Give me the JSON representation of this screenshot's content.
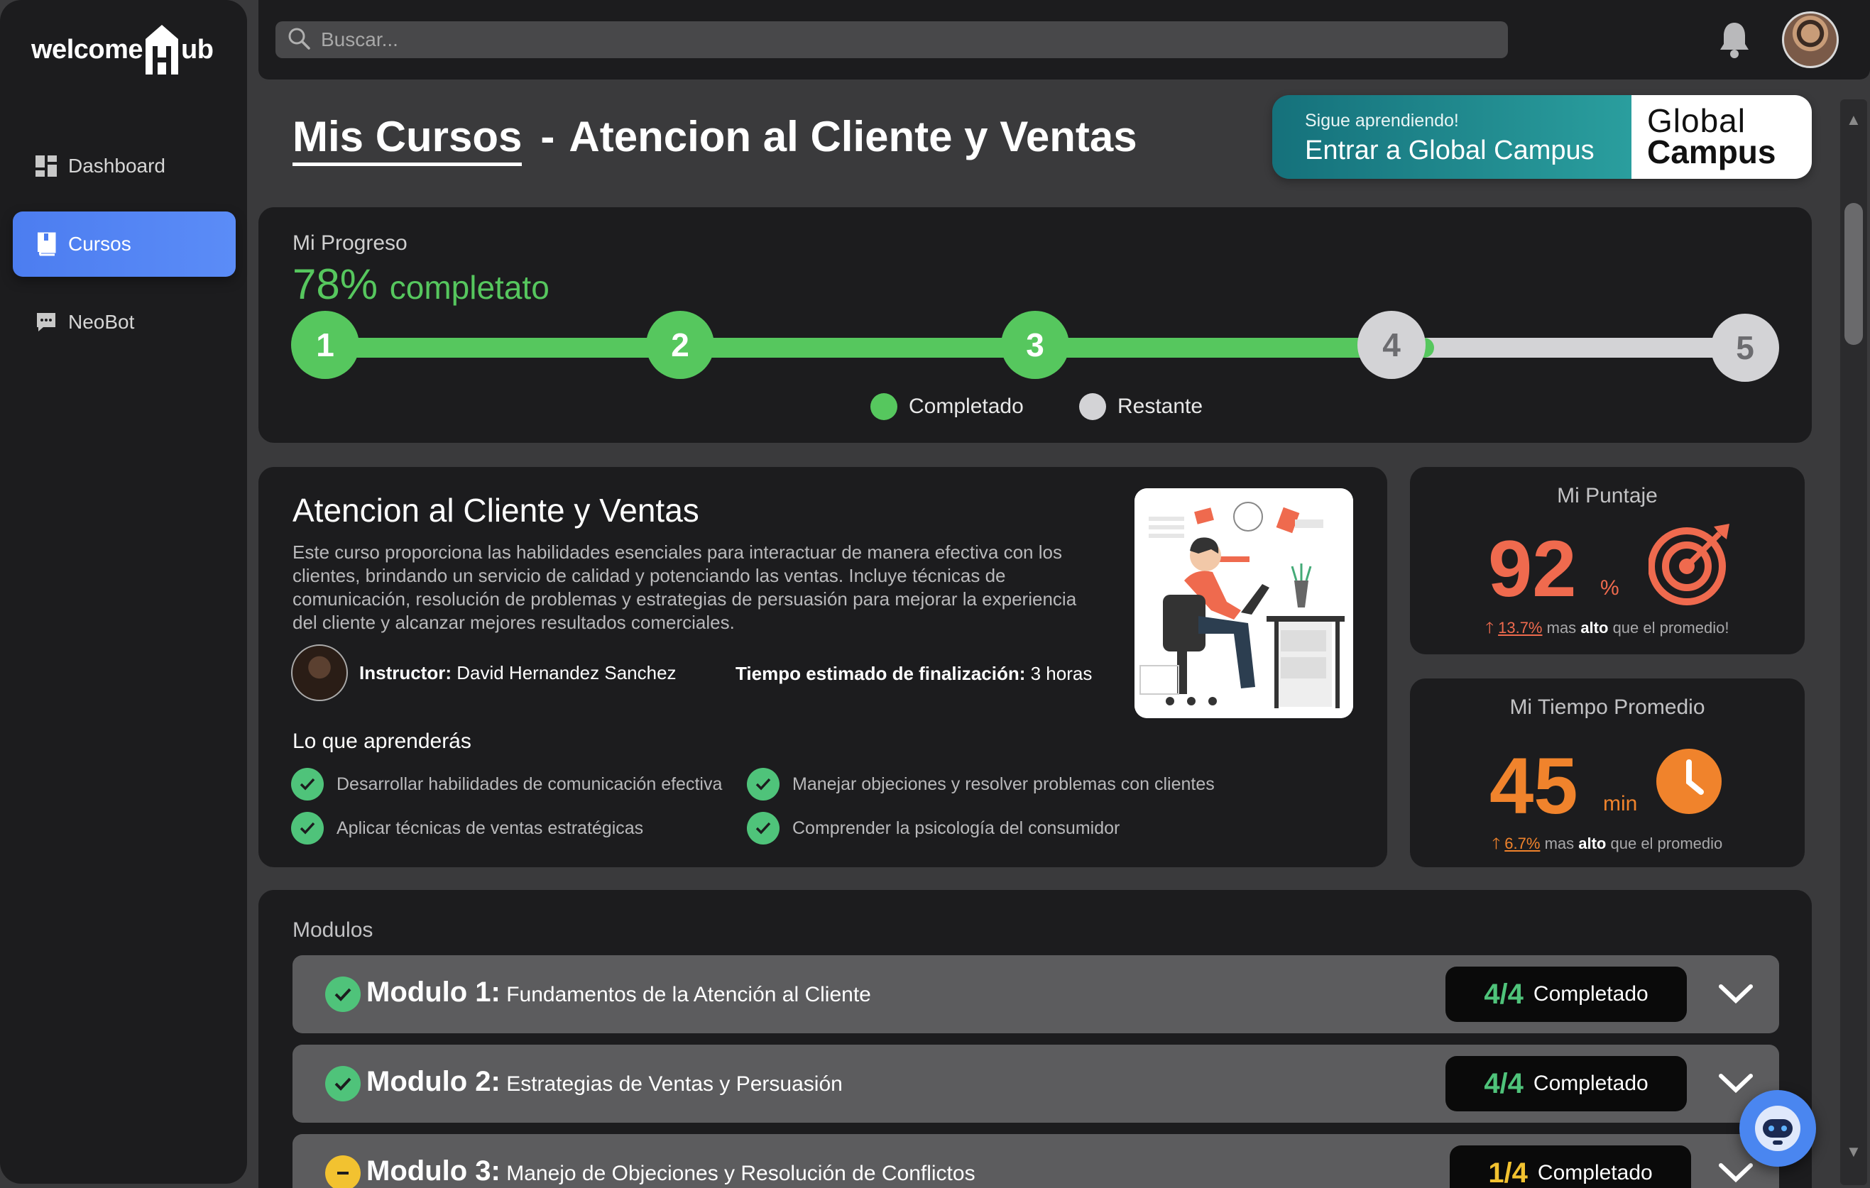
{
  "brand": {
    "logo_pre": "welcome",
    "logo_post": "ub"
  },
  "sidebar": {
    "items": [
      {
        "label": "Dashboard",
        "icon": "dashboard-icon",
        "active": false
      },
      {
        "label": "Cursos",
        "icon": "book-icon",
        "active": true
      },
      {
        "label": "NeoBot",
        "icon": "chat-icon",
        "active": false
      }
    ]
  },
  "topbar": {
    "search_placeholder": "Buscar...",
    "bell_icon": "bell-icon",
    "avatar_icon": "user-avatar"
  },
  "header": {
    "crumb": "Mis Cursos",
    "separator": "-",
    "course_name": "Atencion al Cliente y Ventas"
  },
  "campus": {
    "subtitle": "Sigue aprendiendo!",
    "cta": "Entrar a Global Campus",
    "logo_line1": "Global",
    "logo_line2": "Campus"
  },
  "progress": {
    "label": "Mi Progreso",
    "percent_text": "78%",
    "percent_word": "completato",
    "percent_value": 78,
    "steps": [
      {
        "label": "1",
        "status": "done"
      },
      {
        "label": "2",
        "status": "done"
      },
      {
        "label": "3",
        "status": "done"
      },
      {
        "label": "4",
        "status": "todo"
      },
      {
        "label": "5",
        "status": "todo"
      }
    ],
    "legend_done": "Completado",
    "legend_todo": "Restante",
    "colors": {
      "done": "#56c75e",
      "todo": "#d3d3d6"
    }
  },
  "course": {
    "title": "Atencion al Cliente y Ventas",
    "description": "Este curso proporciona las habilidades esenciales para interactuar de manera efectiva con los clientes, brindando un servicio de calidad y potenciando las ventas. Incluye técnicas de comunicación, resolución de problemas y estrategias de persuasión para mejorar la experiencia del cliente y alcanzar mejores resultados comerciales.",
    "instructor_label": "Instructor:",
    "instructor_name": "David Hernandez Sanchez",
    "time_label": "Tiempo estimado de finalización:",
    "time_value": "3 horas",
    "learn_title": "Lo que aprenderás",
    "learn_items": [
      "Desarrollar habilidades de comunicación efectiva",
      "Aplicar técnicas de ventas estratégicas",
      "Manejar objeciones y resolver problemas con clientes",
      "Comprender la psicología del consumidor"
    ]
  },
  "score": {
    "title": "Mi Puntaje",
    "value": "92",
    "unit": "%",
    "pct": "13.7%",
    "foot_mid": "mas",
    "foot_bold": "alto",
    "foot_end": "que el promedio!",
    "color": "#ef6a4e",
    "icon": "target-icon"
  },
  "avg_time": {
    "title": "Mi Tiempo Promedio",
    "value": "45",
    "unit": "min",
    "pct": "6.7%",
    "foot_mid": "mas",
    "foot_bold": "alto",
    "foot_end": "que el promedio",
    "color": "#f0832c",
    "icon": "clock-icon"
  },
  "modules": {
    "label": "Modulos",
    "items": [
      {
        "num": "Modulo 1:",
        "title": "Fundamentos de la Atención al Cliente",
        "count": "4/4",
        "status": "Completado",
        "complete": true
      },
      {
        "num": "Modulo 2:",
        "title": "Estrategias de Ventas y Persuasión",
        "count": "4/4",
        "status": "Completado",
        "complete": true
      },
      {
        "num": "Modulo 3:",
        "title": "Manejo de Objeciones y Resolución de Conflictos",
        "count": "1/4",
        "status": "Completado",
        "complete": false
      }
    ]
  },
  "chatbot": {
    "icon": "robot-icon"
  }
}
